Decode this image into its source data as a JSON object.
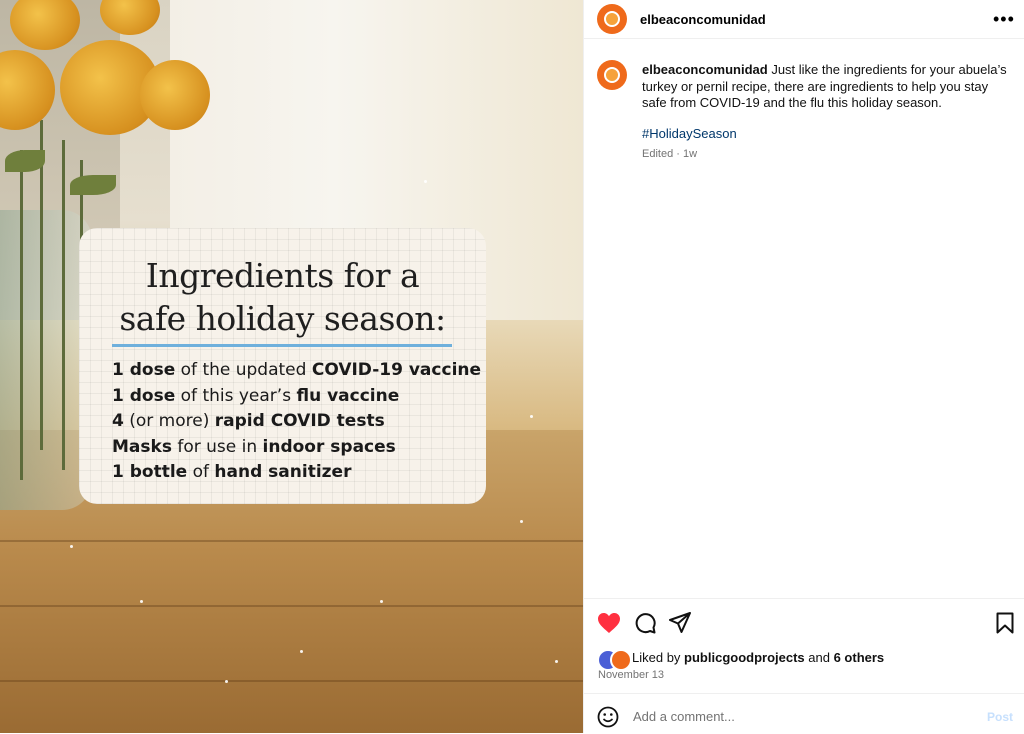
{
  "post": {
    "username": "elbeaconcomunidad",
    "more_label": "•••",
    "caption": "Just like the ingredients for your abuela’s turkey or pernil recipe, there are ingredients to help you stay safe from COVID-19 and the flu this holiday season.",
    "hashtag": "#HolidaySeason",
    "meta": "Edited · 1w",
    "likes": {
      "prefix": "Liked by ",
      "user": "publicgoodprojects",
      "middle": " and ",
      "others": "6 others"
    },
    "date": "November 13",
    "comment_placeholder": "Add a comment...",
    "post_label": "Post",
    "liked": true
  },
  "image_card": {
    "title_line1": "Ingredients for a",
    "title_line2": "safe holiday season:",
    "items": [
      {
        "bold1": "1 dose",
        "plain1": " of the updated ",
        "bold2": "COVID-19 vaccine",
        "plain2": ""
      },
      {
        "bold1": "1 dose",
        "plain1": " of this year’s ",
        "bold2": "flu vaccine",
        "plain2": ""
      },
      {
        "bold1": "4",
        "plain1": " (or more) ",
        "bold2": "rapid COVID tests",
        "plain2": ""
      },
      {
        "bold1": "Masks",
        "plain1": " for use in ",
        "bold2": "indoor spaces",
        "plain2": ""
      },
      {
        "bold1": "1 bottle",
        "plain1": " of ",
        "bold2": "hand sanitizer",
        "plain2": ""
      }
    ]
  },
  "colors": {
    "accent_blue": "#00376b",
    "heart": "#ff3040",
    "avatar": "#ef6a1b",
    "card_rule": "#6fb0dc"
  },
  "icons": [
    "heart-icon",
    "comment-icon",
    "share-icon",
    "bookmark-icon",
    "emoji-icon",
    "more-icon"
  ]
}
